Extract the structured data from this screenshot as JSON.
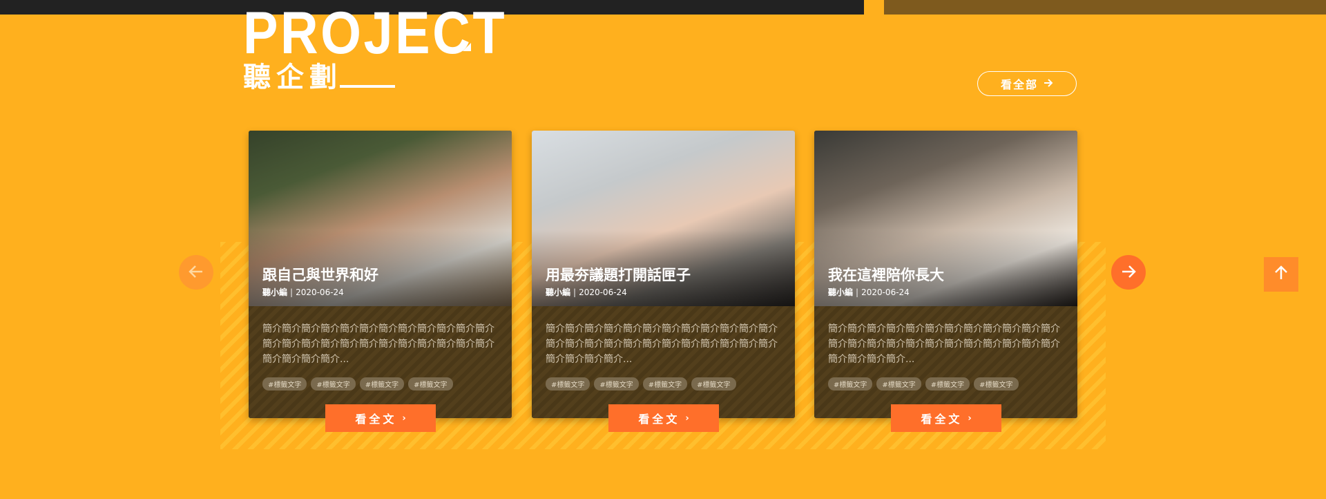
{
  "header": {
    "title": "PROJECT",
    "subtitle": "聽企劃",
    "view_all_label": "看全部",
    "view_all_icon": "arrow-right-icon"
  },
  "carousel": {
    "prev_icon": "arrow-left-icon",
    "next_icon": "arrow-right-icon",
    "cards": [
      {
        "title": "跟自己與世界和好",
        "author": "聽小編",
        "date": "2020-06-24",
        "description": "簡介簡介簡介簡介簡介簡介簡介簡介簡介簡介簡介簡介簡介簡介簡介簡介簡介簡介簡介簡介簡介簡介簡介簡介簡介簡介簡介簡介...",
        "tags": [
          "#標籤文字",
          "#標籤文字",
          "#標籤文字",
          "#標籤文字"
        ],
        "read_more_label": "看全文"
      },
      {
        "title": "用最夯議題打開話匣子",
        "author": "聽小編",
        "date": "2020-06-24",
        "description": "簡介簡介簡介簡介簡介簡介簡介簡介簡介簡介簡介簡介簡介簡介簡介簡介簡介簡介簡介簡介簡介簡介簡介簡介簡介簡介簡介簡介...",
        "tags": [
          "#標籤文字",
          "#標籤文字",
          "#標籤文字",
          "#標籤文字"
        ],
        "read_more_label": "看全文"
      },
      {
        "title": "我在這裡陪你長大",
        "author": "聽小編",
        "date": "2020-06-24",
        "description": "簡介簡介簡介簡介簡介簡介簡介簡介簡介簡介簡介簡介簡介簡介簡介簡介簡介簡介簡介簡介簡介簡介簡介簡介簡介簡介簡介簡介...",
        "tags": [
          "#標籤文字",
          "#標籤文字",
          "#標籤文字",
          "#標籤文字"
        ],
        "read_more_label": "看全文"
      }
    ]
  },
  "scroll_top_icon": "arrow-up-icon",
  "colors": {
    "background": "#FFB01E",
    "accent": "#FF6F2A",
    "card_body": "#4F3B1A",
    "top_bar": "#222222"
  }
}
